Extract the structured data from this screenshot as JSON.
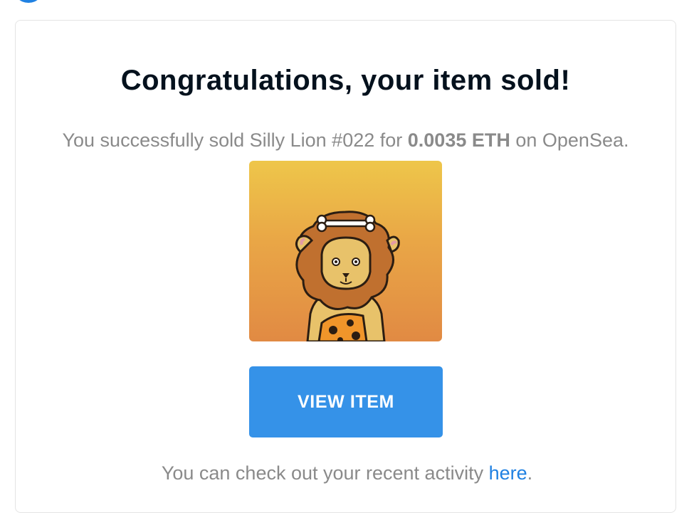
{
  "email": {
    "title": "Congratulations, your item sold!",
    "message": {
      "prefix": "You successfully sold Silly Lion #022 for ",
      "price": "0.0035 ETH",
      "suffix": " on OpenSea."
    },
    "item_image": {
      "subject": "silly-lion-nft",
      "background_top": "#eec64a",
      "background_bottom": "#e18a43"
    },
    "view_button_label": "VIEW ITEM",
    "footer": {
      "prefix": "You can check out your recent activity ",
      "link_label": "here",
      "suffix": "."
    },
    "colors": {
      "accent": "#3592e8",
      "link": "#2081e2",
      "muted_text": "#8a8a8a",
      "title_text": "#04111d"
    }
  }
}
